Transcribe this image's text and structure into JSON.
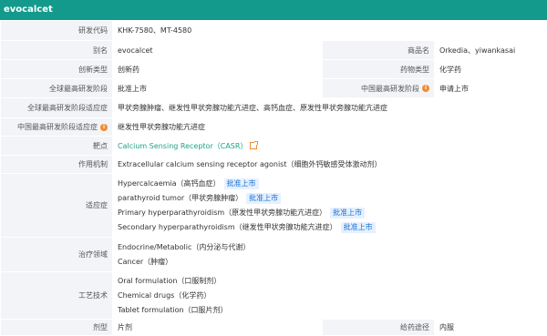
{
  "title": "evocalcet",
  "rows": {
    "code": {
      "label": "研发代码",
      "value": "KHK-7580、MT-4580"
    },
    "alias": {
      "label": "别名",
      "value": "evocalcet",
      "label2": "商品名",
      "value2": "Orkedia、yiwankasai"
    },
    "innovation": {
      "label": "创新类型",
      "value": "创新药",
      "label2": "药物类型",
      "value2": "化学药"
    },
    "global_phase": {
      "label": "全球最高研发阶段",
      "value": "批准上市",
      "label2": "中国最高研发阶段",
      "value2": "申请上市"
    },
    "global_indication": {
      "label": "全球最高研发阶段适应症",
      "value": "甲状旁腺肿瘤、继发性甲状旁腺功能亢进症、高钙血症、原发性甲状旁腺功能亢进症"
    },
    "china_indication": {
      "label": "中国最高研发阶段适应症",
      "value": "继发性甲状旁腺功能亢进症"
    },
    "target": {
      "label": "靶点",
      "value": "Calcium Sensing Receptor（CASR）"
    },
    "mechanism": {
      "label": "作用机制",
      "value": "Extracellular calcium sensing receptor agonist（细胞外钙敏感受体激动剂）"
    },
    "indications": {
      "label": "适应症",
      "items": [
        {
          "text": "Hypercalcaemia（高钙血症）",
          "badge": "批准上市"
        },
        {
          "text": "parathyroid tumor（甲状旁腺肿瘤）",
          "badge": "批准上市"
        },
        {
          "text": "Primary hyperparathyroidism（原发性甲状旁腺功能亢进症）",
          "badge": "批准上市"
        },
        {
          "text": "Secondary hyperparathyroidism（继发性甲状旁腺功能亢进症）",
          "badge": "批准上市"
        }
      ]
    },
    "therapy": {
      "label": "治疗领域",
      "items": [
        "Endocrine/Metabolic（内分泌与代谢）",
        "Cancer（肿瘤）"
      ]
    },
    "tech": {
      "label": "工艺技术",
      "items": [
        "Oral formulation（口服制剂）",
        "Chemical drugs（化学药）",
        "Tablet formulation（口服片剂）"
      ]
    },
    "form": {
      "label": "剂型",
      "value": "片剂",
      "label2": "给药途径",
      "value2": "内服"
    }
  },
  "colors": {
    "header": "#149a8c",
    "label_bg": "#f2f4f7",
    "green": "#17a589",
    "badge_bg": "#e6f0ff",
    "badge_text": "#1a73d1"
  }
}
